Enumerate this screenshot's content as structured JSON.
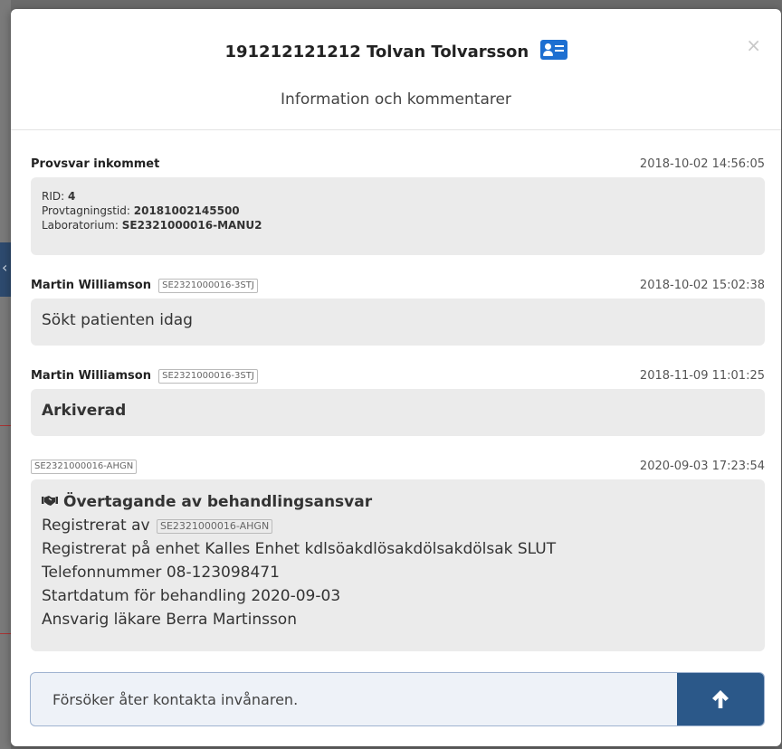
{
  "header": {
    "title": "191212121212 Tolvan Tolvarsson",
    "subtitle": "Information och kommentarer",
    "close_label": "×"
  },
  "entries": [
    {
      "author": "Provsvar inkommet",
      "timestamp": "2018-10-02 14:56:05",
      "lines": [
        {
          "label": "RID: ",
          "value": "4"
        },
        {
          "label": "Provtagningstid: ",
          "value": "20181002145500"
        },
        {
          "label": "Laboratorium: ",
          "value": "SE2321000016-MANU2"
        }
      ]
    },
    {
      "author": "Martin Williamson",
      "tag": "SE2321000016-3STJ",
      "timestamp": "2018-10-02 15:02:38",
      "message": "Sökt patienten idag"
    },
    {
      "author": "Martin Williamson",
      "tag": "SE2321000016-3STJ",
      "timestamp": "2018-11-09 11:01:25",
      "message": "Arkiverad"
    },
    {
      "tag": "SE2321000016-AHGN",
      "timestamp": "2020-09-03 17:23:54",
      "heading": "Övertagande av behandlingsansvar",
      "registered_by_label": "Registrerat av",
      "registered_by_tag": "SE2321000016-AHGN",
      "unit_line": "Registrerat på enhet Kalles Enhet kdlsöakdlösakdölsakdölsak SLUT",
      "phone_line": "Telefonnummer 08-123098471",
      "start_line": "Startdatum för behandling 2020-09-03",
      "doctor_line": "Ansvarig läkare Berra Martinsson"
    }
  ],
  "composer": {
    "value": "Försöker åter kontakta invånaren."
  },
  "colors": {
    "accent": "#2b5889",
    "id_icon": "#1d6fd1",
    "bubble": "#ebebeb"
  },
  "icons": {
    "title_icon": "id-card-icon",
    "entry_icon": "handshake-icon",
    "send_icon": "arrow-up-icon"
  }
}
